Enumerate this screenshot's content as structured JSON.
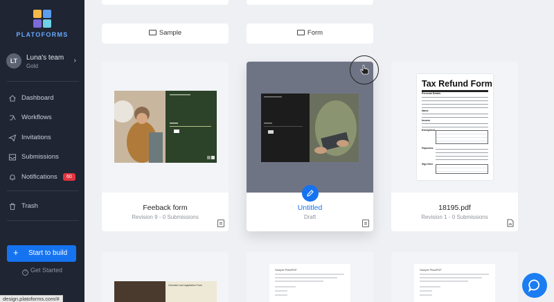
{
  "brand": {
    "name": "PLATOFORMS",
    "colors": {
      "tl": "#f5b94a",
      "tr": "#5c9ded",
      "bl": "#7a6bd8",
      "br": "#6fd0e6"
    }
  },
  "team": {
    "initials": "LT",
    "name": "Luna's team",
    "plan": "Gold"
  },
  "nav": {
    "items": [
      {
        "label": "Dashboard",
        "icon": "home-icon"
      },
      {
        "label": "Workflows",
        "icon": "workflow-icon"
      },
      {
        "label": "Invitations",
        "icon": "send-icon"
      },
      {
        "label": "Submissions",
        "icon": "inbox-icon"
      },
      {
        "label": "Notifications",
        "icon": "bell-icon",
        "badge": "60"
      },
      {
        "label": "Trash",
        "icon": "trash-icon"
      }
    ]
  },
  "actions": {
    "start_build": "Start to build",
    "get_started": "Get Started"
  },
  "folders": [
    {
      "label": "Sample"
    },
    {
      "label": "Form"
    }
  ],
  "forms": [
    {
      "title": "Feeback form",
      "meta": "Revision 9 - 0 Submissions",
      "type_icon": "form-icon"
    },
    {
      "title": "Untitled",
      "meta": "Draft",
      "type_icon": "form-icon"
    },
    {
      "title": "18195.pdf",
      "meta": "Revision 1 - 0 Submissions",
      "type_icon": "pdf-icon"
    }
  ],
  "pdf_preview": {
    "heading": "Tax Refund Form",
    "section_personal": "Personal Details",
    "section_name": "Name",
    "section_income": "Income",
    "section_exemptions": "Exemptions",
    "section_payments": "Payments",
    "section_sign": "Sign Here"
  },
  "bottom_preview": {
    "doc_title": "Sample PlatoPDF",
    "banner_text": "Volunteer and registration Form"
  },
  "status_url": "design.platoforms.com/#",
  "accent": "#1673f0"
}
